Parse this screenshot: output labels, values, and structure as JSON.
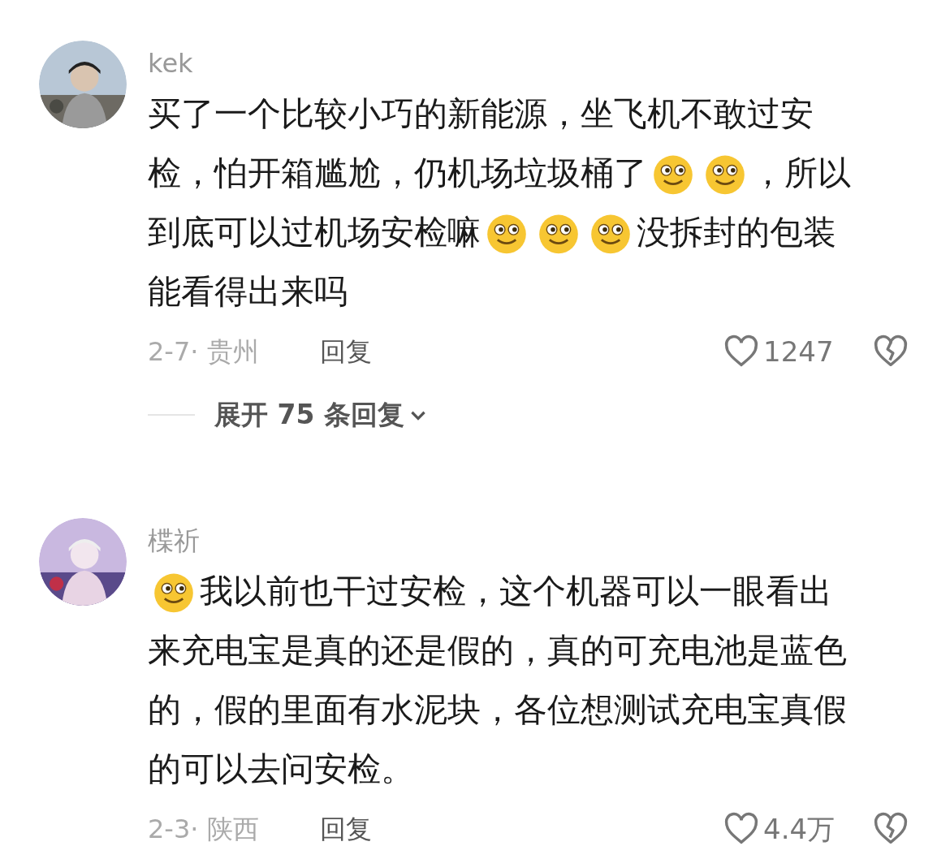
{
  "comments": [
    {
      "user": "kek",
      "avatar": {
        "kind": "picture"
      },
      "content": [
        [
          {
            "kind": "text",
            "text": "买了一个比较小巧的新能源，坐飞机不敢过安"
          }
        ],
        [
          {
            "kind": "text",
            "text": "检，怕开箱尴尬，仍机场垃圾桶了"
          },
          {
            "kind": "emoji"
          },
          {
            "kind": "emoji"
          },
          {
            "kind": "text",
            "text": "，所以"
          }
        ],
        [
          {
            "kind": "text",
            "text": "到底可以过机场安检嘛"
          },
          {
            "kind": "emoji"
          },
          {
            "kind": "emoji"
          },
          {
            "kind": "emoji"
          },
          {
            "kind": "text",
            "text": "没拆封的包装"
          }
        ],
        [
          {
            "kind": "text",
            "text": "能看得出来吗"
          }
        ]
      ],
      "meta": "2-7· 贵州",
      "reply": "回复",
      "likes": "1247",
      "expand": "展开 75 条回复"
    },
    {
      "user": "楪祈",
      "avatar": {
        "kind": "picture"
      },
      "content": [
        [
          {
            "kind": "emoji"
          },
          {
            "kind": "text",
            "text": "我以前也干过安检，这个机器可以一眼看出"
          }
        ],
        [
          {
            "kind": "text",
            "text": "来充电宝是真的还是假的，真的可充电池是蓝色"
          }
        ],
        [
          {
            "kind": "text",
            "text": "的，假的里面有水泥块，各位想测试充电宝真假"
          }
        ],
        [
          {
            "kind": "text",
            "text": "的可以去问安检。"
          }
        ]
      ],
      "meta": "2-3· 陕西",
      "reply": "回复",
      "likes": "4.4万"
    }
  ]
}
